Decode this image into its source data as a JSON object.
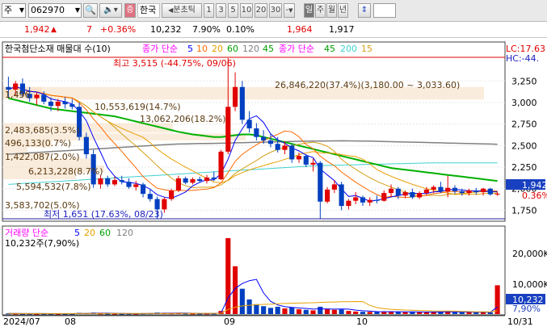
{
  "toolbar": {
    "market_select": "주",
    "code_input": "062970",
    "market_badge": "증",
    "stock_name": "한국",
    "period_label": "분초틱",
    "minute_options": [
      "1",
      "3",
      "5",
      "10",
      "20",
      "30"
    ],
    "minute_dropdown": "-",
    "period_tabs": [
      "일",
      "주",
      "월",
      "년"
    ],
    "active_period": "일"
  },
  "quote": {
    "price": "1,942",
    "change_arrow": "▲",
    "change": "7",
    "change_pct": "+0.36%",
    "volume": "10,232",
    "turnover_pct": "7.90%",
    "other_pct": "0.10%",
    "high": "1,964",
    "low": "1,917"
  },
  "price_panel": {
    "legend_stock": "한국첨단소재 매물대 수(10)",
    "legend_ma_label": "종가 단순",
    "legend_ma_periods": [
      "5",
      "10",
      "20",
      "60",
      "120",
      "45"
    ],
    "legend_ma2_label": "종가 단순",
    "legend_ma2_periods": [
      "45",
      "200",
      "15"
    ],
    "lc_label": "LC:17.63",
    "hc_label": "HC:-44.",
    "max_label": "최고 3,515 (-44.75%, 09/06)",
    "min_label": "최저 1,651 (17.63%, 08/23)",
    "volume_profile_labels": [
      "26,846,220(37.4%)(3,180.00 ~ 3,033.60)",
      "10,553,619(14.7%)",
      "13,062,206(18.2%)",
      "2,483,685(3.5%)",
      "496,133(0.7%)",
      "1,422,087(2.0%)",
      "6,213,228(8.7%)",
      "5,594,532(7.8%)",
      "3,583,702(5.0%)",
      "1,496"
    ],
    "y_ticks": [
      "3,250",
      "3,000",
      "2,750",
      "2,500",
      "2,250",
      "2,000",
      "1,750"
    ],
    "current_price_tag": "1,942",
    "current_pct_tag": "0.36%"
  },
  "volume_panel": {
    "legend_label": "거래량 단순",
    "legend_periods": [
      "5",
      "20",
      "60",
      "120"
    ],
    "value_label": "10,232주(7,90%)",
    "y_ticks": [
      "20,000K",
      "10,000K"
    ],
    "current_tag": "10,232",
    "current_pct_tag": "7,90%"
  },
  "x_axis": {
    "labels": [
      "2024/07",
      "08",
      "09",
      "10",
      "10/31"
    ]
  },
  "colors": {
    "up": "#e00000",
    "down": "#0040c0",
    "ma5": "#0000ff",
    "ma10": "#ff6a00",
    "ma20": "#e8a000",
    "ma60": "#00b000",
    "ma120": "#808080",
    "ma200": "#40d0d0",
    "ma_gold": "#d4a017"
  },
  "chart_data": {
    "type": "candlestick",
    "note_y": "price",
    "candles": [
      {
        "o": 3180,
        "h": 3300,
        "l": 3050,
        "c": 3150
      },
      {
        "o": 3150,
        "h": 3250,
        "l": 3080,
        "c": 3220
      },
      {
        "o": 3220,
        "h": 3280,
        "l": 3060,
        "c": 3100
      },
      {
        "o": 3100,
        "h": 3180,
        "l": 3010,
        "c": 3050
      },
      {
        "o": 3050,
        "h": 3120,
        "l": 2970,
        "c": 3090
      },
      {
        "o": 3090,
        "h": 3130,
        "l": 2980,
        "c": 3010
      },
      {
        "o": 3010,
        "h": 3060,
        "l": 2900,
        "c": 2960
      },
      {
        "o": 2960,
        "h": 3040,
        "l": 2900,
        "c": 3010
      },
      {
        "o": 3010,
        "h": 3060,
        "l": 2930,
        "c": 2980
      },
      {
        "o": 2980,
        "h": 3040,
        "l": 2920,
        "c": 2950
      },
      {
        "o": 2950,
        "h": 3000,
        "l": 2560,
        "c": 2600
      },
      {
        "o": 2600,
        "h": 2650,
        "l": 2350,
        "c": 2400
      },
      {
        "o": 2400,
        "h": 2450,
        "l": 2010,
        "c": 2050
      },
      {
        "o": 2050,
        "h": 2160,
        "l": 2000,
        "c": 2120
      },
      {
        "o": 2120,
        "h": 2150,
        "l": 2020,
        "c": 2050
      },
      {
        "o": 2050,
        "h": 2140,
        "l": 2030,
        "c": 2100
      },
      {
        "o": 2100,
        "h": 2150,
        "l": 2050,
        "c": 2080
      },
      {
        "o": 2080,
        "h": 2120,
        "l": 2000,
        "c": 2020
      },
      {
        "o": 2020,
        "h": 2090,
        "l": 1980,
        "c": 2050
      },
      {
        "o": 2050,
        "h": 2070,
        "l": 1900,
        "c": 1940
      },
      {
        "o": 1940,
        "h": 2000,
        "l": 1850,
        "c": 1880
      },
      {
        "o": 1880,
        "h": 1910,
        "l": 1651,
        "c": 1760
      },
      {
        "o": 1760,
        "h": 1900,
        "l": 1720,
        "c": 1880
      },
      {
        "o": 1880,
        "h": 2000,
        "l": 1860,
        "c": 1980
      },
      {
        "o": 1980,
        "h": 2150,
        "l": 1960,
        "c": 2120
      },
      {
        "o": 2120,
        "h": 2140,
        "l": 2050,
        "c": 2070
      },
      {
        "o": 2070,
        "h": 2130,
        "l": 2050,
        "c": 2110
      },
      {
        "o": 2110,
        "h": 2140,
        "l": 2070,
        "c": 2090
      },
      {
        "o": 2090,
        "h": 2160,
        "l": 2060,
        "c": 2130
      },
      {
        "o": 2130,
        "h": 2200,
        "l": 2090,
        "c": 2110
      },
      {
        "o": 2110,
        "h": 2450,
        "l": 2100,
        "c": 2430
      },
      {
        "o": 2430,
        "h": 3515,
        "l": 2400,
        "c": 2950
      },
      {
        "o": 2950,
        "h": 3350,
        "l": 2900,
        "c": 3180
      },
      {
        "o": 3180,
        "h": 3250,
        "l": 2750,
        "c": 2800
      },
      {
        "o": 2800,
        "h": 2900,
        "l": 2650,
        "c": 2700
      },
      {
        "o": 2700,
        "h": 2760,
        "l": 2560,
        "c": 2600
      },
      {
        "o": 2600,
        "h": 2680,
        "l": 2520,
        "c": 2560
      },
      {
        "o": 2560,
        "h": 2640,
        "l": 2480,
        "c": 2520
      },
      {
        "o": 2520,
        "h": 2600,
        "l": 2420,
        "c": 2450
      },
      {
        "o": 2450,
        "h": 2550,
        "l": 2400,
        "c": 2500
      },
      {
        "o": 2500,
        "h": 2520,
        "l": 2300,
        "c": 2340
      },
      {
        "o": 2340,
        "h": 2420,
        "l": 2300,
        "c": 2380
      },
      {
        "o": 2380,
        "h": 2400,
        "l": 2250,
        "c": 2280
      },
      {
        "o": 2280,
        "h": 2350,
        "l": 2200,
        "c": 2300
      },
      {
        "o": 2300,
        "h": 2320,
        "l": 1651,
        "c": 1850
      },
      {
        "o": 1850,
        "h": 2020,
        "l": 1830,
        "c": 1990
      },
      {
        "o": 1990,
        "h": 2100,
        "l": 1950,
        "c": 2050
      },
      {
        "o": 2050,
        "h": 2080,
        "l": 1750,
        "c": 1800
      },
      {
        "o": 1800,
        "h": 1880,
        "l": 1760,
        "c": 1860
      },
      {
        "o": 1860,
        "h": 1960,
        "l": 1820,
        "c": 1900
      },
      {
        "o": 1900,
        "h": 1920,
        "l": 1800,
        "c": 1840
      },
      {
        "o": 1840,
        "h": 1900,
        "l": 1800,
        "c": 1870
      },
      {
        "o": 1870,
        "h": 1920,
        "l": 1830,
        "c": 1860
      },
      {
        "o": 1860,
        "h": 1980,
        "l": 1850,
        "c": 1950
      },
      {
        "o": 1950,
        "h": 2050,
        "l": 1900,
        "c": 2000
      },
      {
        "o": 2000,
        "h": 2020,
        "l": 1880,
        "c": 1920
      },
      {
        "o": 1920,
        "h": 1980,
        "l": 1890,
        "c": 1960
      },
      {
        "o": 1960,
        "h": 2000,
        "l": 1880,
        "c": 1900
      },
      {
        "o": 1900,
        "h": 1970,
        "l": 1880,
        "c": 1950
      },
      {
        "o": 1950,
        "h": 2020,
        "l": 1920,
        "c": 1990
      },
      {
        "o": 1990,
        "h": 2040,
        "l": 1950,
        "c": 2020
      },
      {
        "o": 2020,
        "h": 2080,
        "l": 1950,
        "c": 1970
      },
      {
        "o": 1970,
        "h": 2150,
        "l": 1900,
        "c": 2010
      },
      {
        "o": 2010,
        "h": 2040,
        "l": 1940,
        "c": 1970
      },
      {
        "o": 1970,
        "h": 2000,
        "l": 1920,
        "c": 1950
      },
      {
        "o": 1950,
        "h": 2000,
        "l": 1920,
        "c": 1980
      },
      {
        "o": 1980,
        "h": 2010,
        "l": 1930,
        "c": 1960
      },
      {
        "o": 1960,
        "h": 2010,
        "l": 1920,
        "c": 2000
      },
      {
        "o": 2000,
        "h": 2010,
        "l": 1920,
        "c": 1935
      },
      {
        "o": 1935,
        "h": 1964,
        "l": 1917,
        "c": 1942
      }
    ],
    "volumes_k": [
      220,
      180,
      150,
      170,
      140,
      160,
      150,
      130,
      140,
      150,
      420,
      300,
      500,
      200,
      160,
      150,
      140,
      170,
      160,
      230,
      260,
      520,
      380,
      260,
      340,
      220,
      180,
      170,
      190,
      200,
      1100,
      27000,
      17000,
      9000,
      5200,
      3500,
      2800,
      2200,
      2600,
      2000,
      2300,
      1700,
      1500,
      1300,
      2600,
      1900,
      1500,
      1600,
      1100,
      900,
      800,
      760,
      820,
      900,
      950,
      700,
      650,
      720,
      690,
      760,
      800,
      700,
      900,
      650,
      620,
      640,
      600,
      700,
      620,
      10232
    ],
    "ma_lines": {
      "ma60": [
        3050,
        3030,
        3010,
        2990,
        2970,
        2950,
        2930,
        2920,
        2910,
        2900,
        2890,
        2880,
        2870,
        2860,
        2850,
        2840,
        2820,
        2800,
        2780,
        2760,
        2740,
        2720,
        2700,
        2680,
        2660,
        2645,
        2630,
        2620,
        2610,
        2600,
        2600,
        2610,
        2620,
        2630,
        2630,
        2620,
        2600,
        2580,
        2560,
        2540,
        2520,
        2500,
        2480,
        2460,
        2440,
        2420,
        2400,
        2380,
        2360,
        2340,
        2320,
        2300,
        2280,
        2260,
        2240,
        2230,
        2220,
        2210,
        2200,
        2190,
        2180,
        2170,
        2160,
        2150,
        2140,
        2130,
        2120,
        2110,
        2100,
        2090
      ],
      "ma120": [
        2400,
        2405,
        2410,
        2415,
        2420,
        2425,
        2430,
        2435,
        2440,
        2445,
        2450,
        2455,
        2460,
        2465,
        2470,
        2475,
        2480,
        2485,
        2490,
        2495,
        2500,
        2505,
        2510,
        2515,
        2518,
        2520,
        2522,
        2524,
        2525,
        2526,
        2528,
        2530,
        2532,
        2534,
        2536,
        2538,
        2540,
        2542,
        2544,
        2546,
        2548,
        2550,
        2551,
        2552,
        2553,
        2554,
        2555,
        2556,
        2555,
        2554,
        2553,
        2552,
        2550,
        2548,
        2546,
        2544,
        2542,
        2540,
        2538,
        2536,
        2534,
        2532,
        2530,
        2528,
        2526,
        2524,
        2522,
        2520,
        2518,
        2516
      ],
      "ma200": [
        2050,
        2055,
        2060,
        2065,
        2070,
        2075,
        2080,
        2085,
        2090,
        2095,
        2100,
        2105,
        2110,
        2115,
        2120,
        2125,
        2130,
        2135,
        2140,
        2145,
        2150,
        2155,
        2160,
        2165,
        2170,
        2175,
        2180,
        2185,
        2190,
        2195,
        2200,
        2205,
        2210,
        2215,
        2220,
        2225,
        2230,
        2235,
        2240,
        2245,
        2250,
        2255,
        2260,
        2265,
        2268,
        2270,
        2272,
        2274,
        2276,
        2278,
        2280,
        2282,
        2284,
        2286,
        2288,
        2290,
        2292,
        2294,
        2296,
        2298,
        2300,
        2300,
        2300,
        2300,
        2300,
        2300,
        2300,
        2300,
        2300,
        2300
      ]
    }
  }
}
